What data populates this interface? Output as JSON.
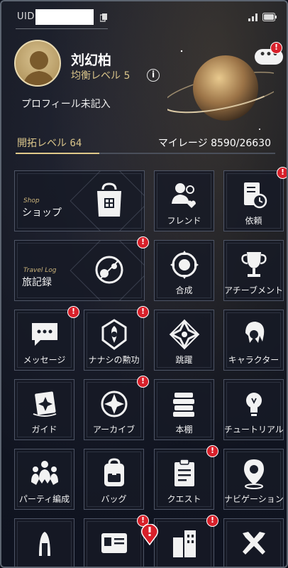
{
  "status": {
    "uid_label": "UID"
  },
  "profile": {
    "name": "刘幻柏",
    "level_label": "均衡レベル 5",
    "more_label": "•••",
    "description": "プロフィール未記入"
  },
  "progress": {
    "trail_label": "開拓レベル",
    "trail_level": "64",
    "mileage_label": "マイレージ",
    "mileage_value": "8590/26630",
    "mileage_current": 8590,
    "mileage_max": 26630
  },
  "badge_text": "!",
  "info_text": "i",
  "menu": {
    "shop": {
      "label": "ショップ",
      "sub": "Shop"
    },
    "friends": {
      "label": "フレンド"
    },
    "commission": {
      "label": "依頼"
    },
    "travel_log": {
      "label": "旅記録",
      "sub": "Travel Log"
    },
    "synthesis": {
      "label": "合成"
    },
    "achievement": {
      "label": "アチーブメント"
    },
    "message": {
      "label": "メッセージ"
    },
    "nameless_honor": {
      "label": "ナナシの勲功"
    },
    "warp": {
      "label": "跳躍"
    },
    "character": {
      "label": "キャラクター"
    },
    "guide": {
      "label": "ガイド"
    },
    "archive": {
      "label": "アーカイブ"
    },
    "bookshelf": {
      "label": "本棚"
    },
    "tutorial": {
      "label": "チュートリアル"
    },
    "party": {
      "label": "パーティ編成"
    },
    "bag": {
      "label": "バッグ"
    },
    "quest": {
      "label": "クエスト"
    },
    "navigation": {
      "label": "ナビゲーション"
    }
  }
}
